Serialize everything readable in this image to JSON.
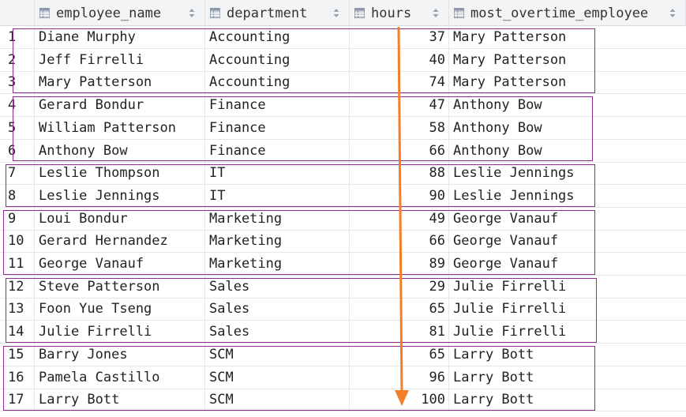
{
  "columns": [
    {
      "key": "employee_name",
      "label": "employee_name"
    },
    {
      "key": "department",
      "label": "department"
    },
    {
      "key": "hours",
      "label": "hours"
    },
    {
      "key": "most_overtime_employee",
      "label": "most_overtime_employee"
    }
  ],
  "rows": [
    {
      "num": "1",
      "employee_name": "Diane Murphy",
      "department": "Accounting",
      "hours": "37",
      "most_overtime_employee": "Mary Patterson"
    },
    {
      "num": "2",
      "employee_name": "Jeff Firrelli",
      "department": "Accounting",
      "hours": "40",
      "most_overtime_employee": "Mary Patterson"
    },
    {
      "num": "3",
      "employee_name": "Mary Patterson",
      "department": "Accounting",
      "hours": "74",
      "most_overtime_employee": "Mary Patterson"
    },
    {
      "num": "4",
      "employee_name": "Gerard Bondur",
      "department": "Finance",
      "hours": "47",
      "most_overtime_employee": "Anthony Bow"
    },
    {
      "num": "5",
      "employee_name": "William Patterson",
      "department": "Finance",
      "hours": "58",
      "most_overtime_employee": "Anthony Bow"
    },
    {
      "num": "6",
      "employee_name": "Anthony Bow",
      "department": "Finance",
      "hours": "66",
      "most_overtime_employee": "Anthony Bow"
    },
    {
      "num": "7",
      "employee_name": "Leslie Thompson",
      "department": "IT",
      "hours": "88",
      "most_overtime_employee": "Leslie Jennings"
    },
    {
      "num": "8",
      "employee_name": "Leslie Jennings",
      "department": "IT",
      "hours": "90",
      "most_overtime_employee": "Leslie Jennings"
    },
    {
      "num": "9",
      "employee_name": "Loui Bondur",
      "department": "Marketing",
      "hours": "49",
      "most_overtime_employee": "George Vanauf"
    },
    {
      "num": "10",
      "employee_name": "Gerard Hernandez",
      "department": "Marketing",
      "hours": "66",
      "most_overtime_employee": "George Vanauf"
    },
    {
      "num": "11",
      "employee_name": "George Vanauf",
      "department": "Marketing",
      "hours": "89",
      "most_overtime_employee": "George Vanauf"
    },
    {
      "num": "12",
      "employee_name": "Steve Patterson",
      "department": "Sales",
      "hours": "29",
      "most_overtime_employee": "Julie Firrelli"
    },
    {
      "num": "13",
      "employee_name": "Foon Yue Tseng",
      "department": "Sales",
      "hours": "65",
      "most_overtime_employee": "Julie Firrelli"
    },
    {
      "num": "14",
      "employee_name": "Julie Firrelli",
      "department": "Sales",
      "hours": "81",
      "most_overtime_employee": "Julie Firrelli"
    },
    {
      "num": "15",
      "employee_name": "Barry Jones",
      "department": "SCM",
      "hours": "65",
      "most_overtime_employee": "Larry Bott"
    },
    {
      "num": "16",
      "employee_name": "Pamela Castillo",
      "department": "SCM",
      "hours": "96",
      "most_overtime_employee": "Larry Bott"
    },
    {
      "num": "17",
      "employee_name": "Larry Bott",
      "department": "SCM",
      "hours": "100",
      "most_overtime_employee": "Larry Bott"
    }
  ],
  "annotations": {
    "group_box_color": "#8e2d8c",
    "arrow_color": "#f47f2a",
    "arrow_meaning": "hours ascending within department"
  },
  "icons": {
    "column_type": "table-column-icon",
    "sort": "sort-toggle-icon"
  }
}
